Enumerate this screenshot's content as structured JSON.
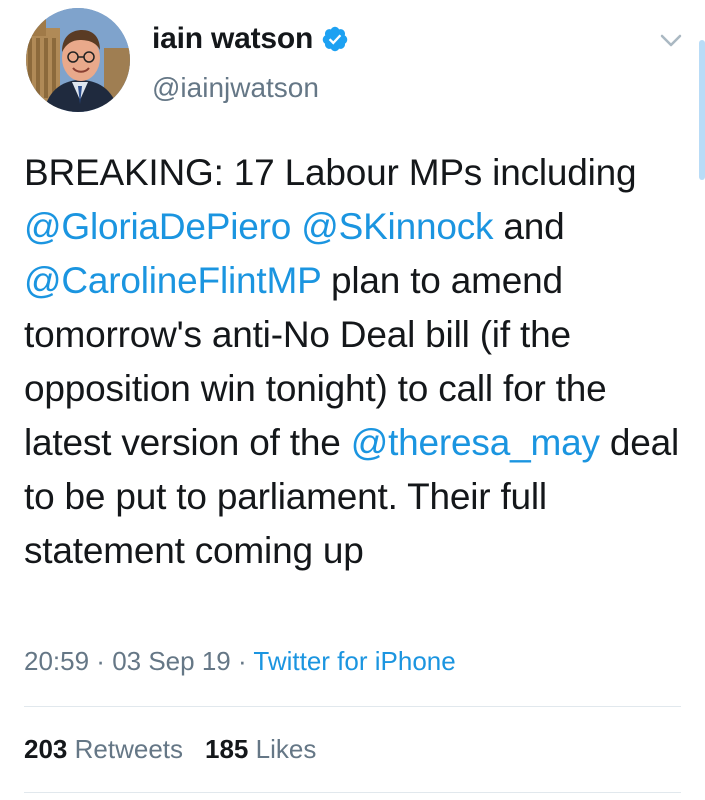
{
  "author": {
    "display_name": "iain watson",
    "handle": "@iainjwatson",
    "verified": true,
    "avatar": "profile-photo-parliament-background"
  },
  "tweet": {
    "segments": [
      {
        "text": "BREAKING: 17 Labour MPs including ",
        "type": "text"
      },
      {
        "text": "@GloriaDePiero",
        "type": "mention"
      },
      {
        "text": " ",
        "type": "text"
      },
      {
        "text": "@SKinnock",
        "type": "mention"
      },
      {
        "text": " and ",
        "type": "text"
      },
      {
        "text": "@CarolineFlintMP",
        "type": "mention"
      },
      {
        "text": " plan to amend tomorrow's anti-No Deal bill (if the opposition win tonight) to call for the latest version of the ",
        "type": "text"
      },
      {
        "text": "@theresa_may",
        "type": "mention"
      },
      {
        "text": " deal to be put to parliament. Their full statement coming up",
        "type": "text"
      }
    ]
  },
  "meta": {
    "time": "20:59",
    "sep1": " · ",
    "date": "03 Sep 19",
    "sep2": " · ",
    "source": "Twitter for iPhone"
  },
  "stats": {
    "retweets_count": "203",
    "retweets_label": "Retweets",
    "likes_count": "185",
    "likes_label": "Likes"
  },
  "colors": {
    "link": "#1b95e0",
    "secondary_text": "#657786",
    "primary_text": "#14171a",
    "divider": "#e1e8ed"
  },
  "icons": {
    "verified": "verified-badge-icon",
    "menu": "chevron-down-icon"
  }
}
